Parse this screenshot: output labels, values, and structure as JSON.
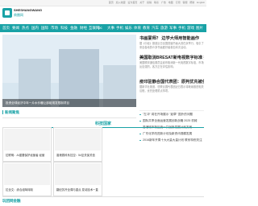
{
  "topbar": {
    "links": [
      "首页",
      "加入收藏",
      "设为首页",
      "关于",
      "投稿",
      "联系",
      "广告",
      "地图",
      "订阅",
      "客服",
      "帮助",
      "English"
    ]
  },
  "brand": {
    "name_en": "SHESHANGWANG",
    "name_cn": "商圈网",
    "accent": "#19a2a6"
  },
  "nav": {
    "items": [
      "首页",
      "要闻",
      "热点",
      "国内",
      "国际",
      "市场",
      "科技",
      "金融",
      "财经",
      "互联网",
      "pc",
      "大事",
      "手机",
      "娱乐",
      "体育",
      "教育",
      "汽车",
      "旅游",
      "军事",
      "手机",
      "游戏",
      "图片"
    ]
  },
  "hero": {
    "caption": "投资全球经济中年一片水价暖让部组规发限制项目",
    "slides": 4,
    "active_slide": 1
  },
  "section1": {
    "label": "新闻聚焦"
  },
  "right": {
    "headline1": "书画宴师？ 边学大师用智能画作",
    "summary1": "据《中经》报道近日全国首届书画大赛在京举行，吸引了来自各地的众多书画爱好者参加本次活动。",
    "headline2": "美国取消BRESAT新电视数字标准 打中",
    "summary2": "美国联邦通信委员会宣布取消新一代电视数字标准，市场反应强烈，各方正在评估影响。",
    "headline3": "疫印驻静合国代表团：原判优先被任",
    "summary3": "据新华社报道，驻联合国代表团近日表示将继续推进相关议程，优先处理重点事项。",
    "list": [
      "\"左冲\" 将在开场展示 \"起草\" 国外的问题",
      "国际共享全面运营发展创新战略 2025 机械",
      "香港城市新区统一共创新发展计划方案",
      "广东化学改进新计划及新资讯规模发展",
      "2016新年开周十大大量大量计划 联系特别关注"
    ]
  },
  "tech": {
    "label": "科技国家"
  },
  "cards": [
    {
      "title": "拉联明：AI重要保护经营者 经营"
    },
    {
      "title": "香港赛科系控空：54至关保关信"
    },
    {
      "title": "拉全文：综合组驾特制"
    },
    {
      "title": "翻纪苏开全课与重点 发动技术一直"
    }
  ],
  "section2": {
    "label": "玩团网金融"
  }
}
